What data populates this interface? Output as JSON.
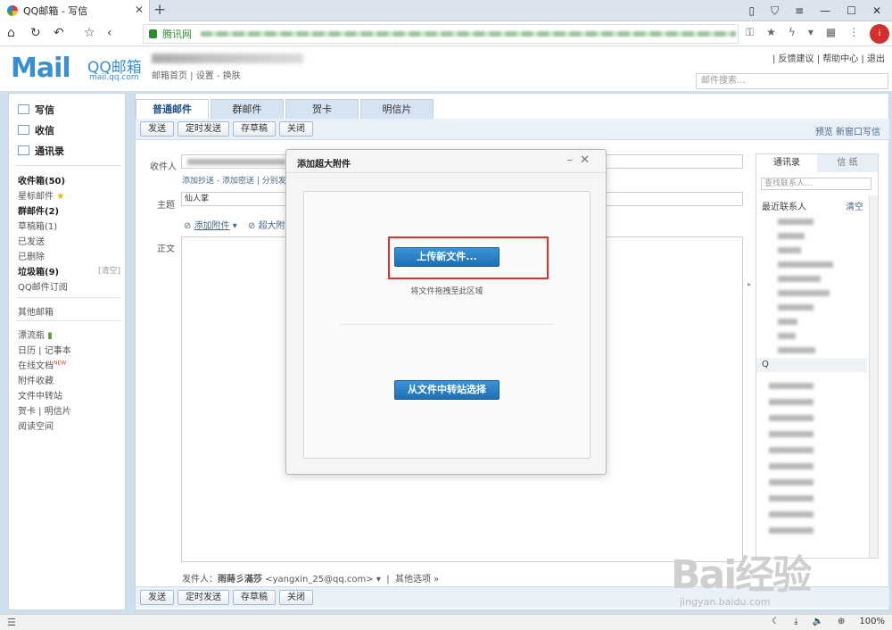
{
  "browser": {
    "tab_title": "QQ邮箱 - 写信",
    "site_label": "腾讯网",
    "avatar_text": "i",
    "zoom": "100%"
  },
  "header": {
    "logo_text": "Mail",
    "name": "QQ邮箱",
    "domain": "mail.qq.com",
    "user_links": "邮箱首页 | 设置 - 换肤",
    "top_links": "| 反馈建议 | 帮助中心 | 退出",
    "search_placeholder": "邮件搜索..."
  },
  "sidebar": {
    "primary": [
      {
        "label": "写信"
      },
      {
        "label": "收信"
      },
      {
        "label": "通讯录"
      }
    ],
    "folders": [
      {
        "label": "收件箱(50)"
      },
      {
        "label": "星标邮件"
      },
      {
        "label": "群邮件(2)"
      },
      {
        "label": "草稿箱(1)"
      },
      {
        "label": "已发送"
      },
      {
        "label": "已删除"
      },
      {
        "label": "垃圾箱(9)"
      },
      {
        "label": "QQ邮件订阅"
      }
    ],
    "clear_label": "[清空]",
    "other_mail": "其他邮箱",
    "apps": [
      {
        "label": "漂流瓶"
      },
      {
        "label": "日历 | 记事本"
      },
      {
        "label": "在线文档"
      },
      {
        "label": "附件收藏"
      },
      {
        "label": "文件中转站"
      },
      {
        "label": "贺卡 | 明信片"
      },
      {
        "label": "阅读空间"
      }
    ],
    "new_badge": "NEW"
  },
  "compose": {
    "tabs": [
      {
        "label": "普通邮件"
      },
      {
        "label": "群邮件"
      },
      {
        "label": "贺卡"
      },
      {
        "label": "明信片"
      }
    ],
    "buttons": {
      "send": "发送",
      "timed_send": "定时发送",
      "save_draft": "存草稿",
      "close": "关闭"
    },
    "toolbar_right": "预览   新窗口写信",
    "to_label": "收件人",
    "cc_links": "添加抄送 - 添加密送 | 分别发",
    "subject_label": "主题",
    "subject_value": "仙人掌",
    "attach_label": "添加附件",
    "big_attach_label": "超大附",
    "body_label": "正文",
    "sender_label": "发件人：",
    "sender_name": "雨蒔彡滿莎",
    "sender_email": "<yangxin_25@qq.com>",
    "other_options": "其他选项"
  },
  "contacts": {
    "tabs": [
      {
        "label": "通讯录"
      },
      {
        "label": "信 纸"
      }
    ],
    "search_placeholder": "查找联系人...",
    "recent_label": "最近联系人",
    "clear_label": "清空",
    "group_label": "Q"
  },
  "dialog": {
    "title": "添加超大附件",
    "upload_button": "上传新文件...",
    "drag_hint": "将文件拖拽至此区域",
    "transfer_button": "从文件中转站选择"
  },
  "watermark": {
    "brand": "Bai经验",
    "url": "jingyan.baidu.com"
  }
}
